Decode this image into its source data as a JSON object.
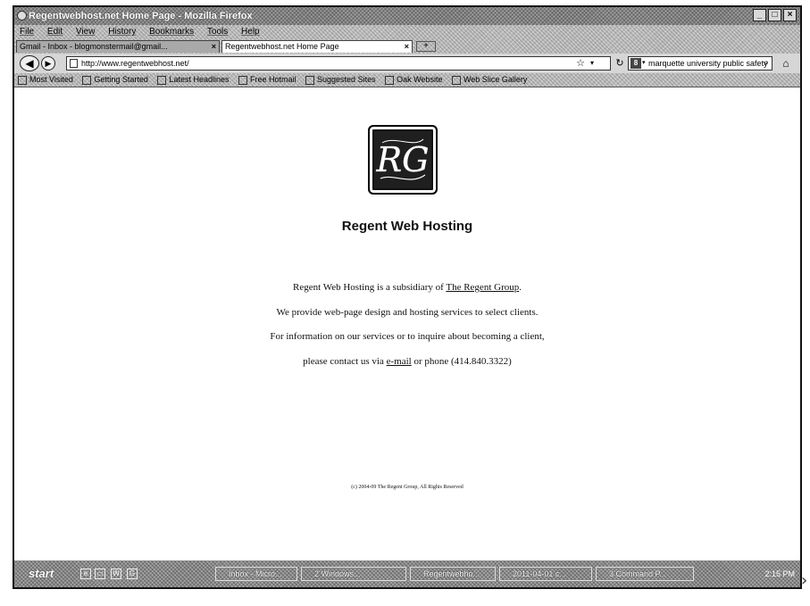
{
  "window": {
    "title": "Regentwebhost.net Home Page - Mozilla Firefox",
    "controls": [
      "_",
      "□",
      "×"
    ]
  },
  "menu": [
    "File",
    "Edit",
    "View",
    "History",
    "Bookmarks",
    "Tools",
    "Help"
  ],
  "tabs": [
    {
      "label": "Gmail - Inbox - blogmonstermail@gmail...",
      "active": false
    },
    {
      "label": "Regentwebhost.net Home Page",
      "active": true
    }
  ],
  "navigation": {
    "url": "http://www.regentwebhost.net/",
    "search_value": "marquette university public safety"
  },
  "bookmarks": [
    "Most Visited",
    "Getting Started",
    "Latest Headlines",
    "Free Hotmail",
    "Suggested Sites",
    "Oak Website",
    "Web Slice Gallery"
  ],
  "page": {
    "logo_text": "RG",
    "title": "Regent Web Hosting",
    "line1_prefix": "Regent Web Hosting is a subsidiary of ",
    "line1_link": "The Regent Group",
    "line1_suffix": ".",
    "line2": "We provide web-page design and hosting services to select clients.",
    "line3": "For information on our services or to inquire about becoming a client,",
    "line4_prefix": "please contact us via ",
    "line4_link": "e-mail",
    "line4_suffix": " or phone (414.840.3322)",
    "copyright": "(c) 2004-09 The Regent Group, All Rights Reserved"
  },
  "taskbar": {
    "start": "start",
    "tasks": [
      "Inbox - Micro...",
      "2 Windows...",
      "Regentwebho...",
      "2011-04-01 c...",
      "3 Command P..."
    ],
    "clock": "2:15 PM"
  }
}
